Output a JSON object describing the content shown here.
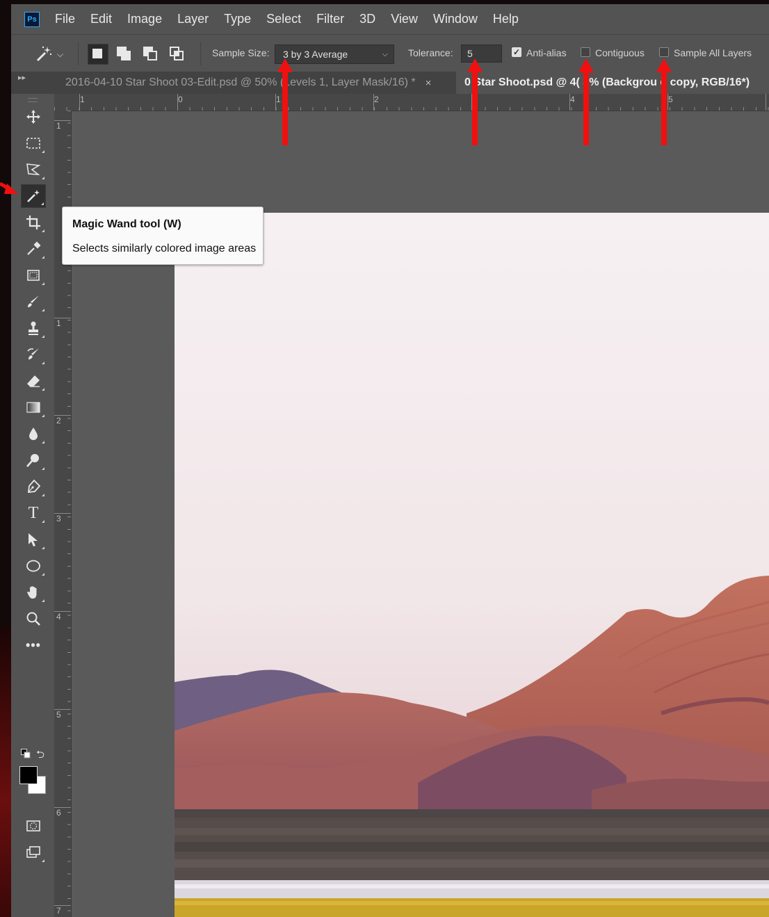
{
  "app": {
    "logo": "Ps"
  },
  "menu": [
    "File",
    "Edit",
    "Image",
    "Layer",
    "Type",
    "Select",
    "Filter",
    "3D",
    "View",
    "Window",
    "Help"
  ],
  "options_bar": {
    "sample_size_label": "Sample Size:",
    "sample_size_value": "3 by 3 Average",
    "tolerance_label": "Tolerance:",
    "tolerance_value": "5",
    "anti_alias_label": "Anti-alias",
    "anti_alias_checked": true,
    "contiguous_label": "Contiguous",
    "contiguous_checked": false,
    "sample_all_layers_label": "Sample All Layers",
    "sample_all_layers_checked": false
  },
  "tabs": [
    {
      "label": "2016-04-10 Star Shoot 03-Edit.psd @ 50% (Levels 1, Layer Mask/16) *",
      "close": "×",
      "active": false
    },
    {
      "label": "0  Star Shoot.psd @ 4( 3% (Backgrou  d copy, RGB/16*)",
      "active": true
    }
  ],
  "tools": [
    "move-icon",
    "rectangular-marquee-icon",
    "polygonal-lasso-icon",
    "magic-wand-icon",
    "crop-icon",
    "eyedropper-icon",
    "frame-icon",
    "brush-icon",
    "clone-stamp-icon",
    "history-brush-icon",
    "eraser-icon",
    "gradient-icon",
    "blur-icon",
    "dodge-icon",
    "pen-icon",
    "type-icon",
    "path-selection-icon",
    "ellipse-icon",
    "hand-icon",
    "zoom-icon",
    "more-tools-icon"
  ],
  "colors": {
    "foreground": "#000000",
    "background": "#ffffff",
    "annotation": "#ff0000"
  },
  "tooltip": {
    "title": "Magic Wand tool (W)",
    "description": "Selects similarly colored image areas"
  },
  "ruler_top": [
    "1",
    "0",
    "1",
    "2",
    "4",
    "5"
  ],
  "ruler_left": [
    "1",
    "1",
    "2",
    "3",
    "4",
    "5",
    "6",
    "7"
  ]
}
